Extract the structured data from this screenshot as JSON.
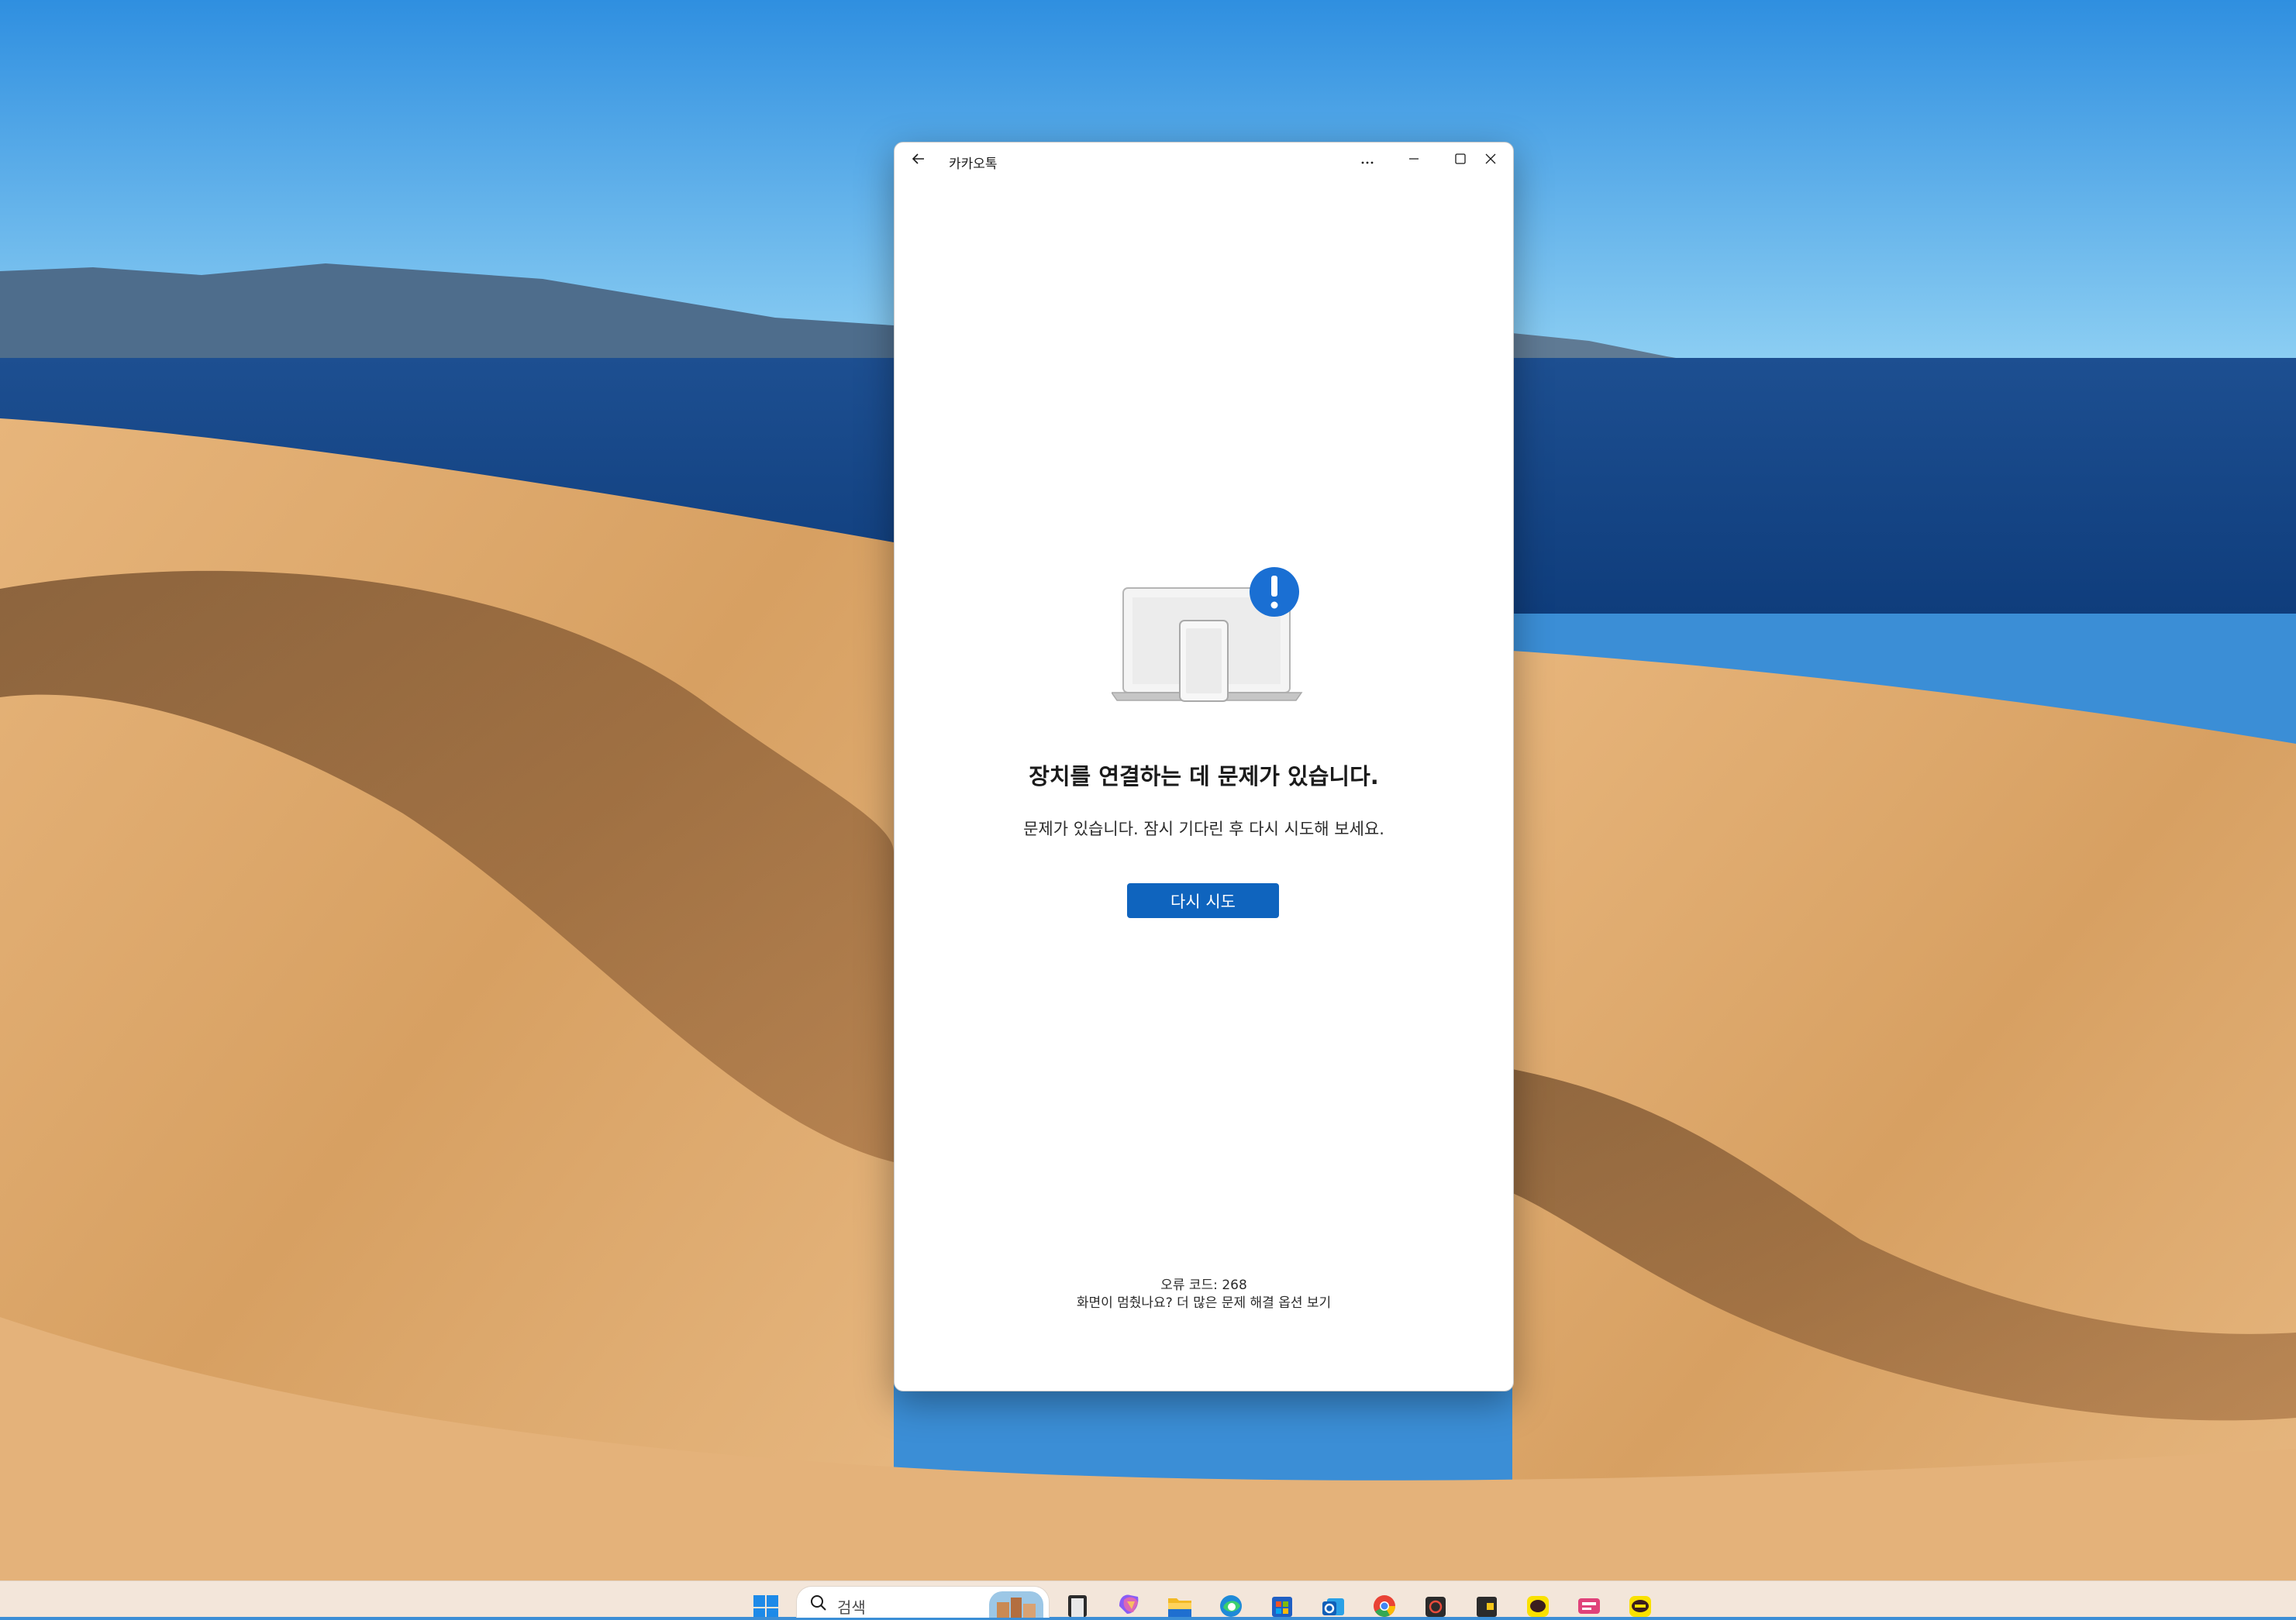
{
  "window": {
    "app_title": "카카오톡",
    "back_icon": "arrow-left-icon",
    "controls": {
      "more_icon": "more-horizontal-icon",
      "minimize_icon": "minimize-icon",
      "maximize_icon": "maximize-icon",
      "close_icon": "close-icon"
    }
  },
  "error": {
    "illustration_icon": "device-connection-error-icon",
    "heading": "장치를 연결하는 데 문제가 있습니다.",
    "message": "문제가 있습니다. 잠시 기다린 후 다시 시도해 보세요.",
    "retry_label": "다시 시도",
    "error_code": "오류 코드: 268",
    "help_link": "화면이 멈췄나요? 더 많은 문제 해결 옵션 보기"
  },
  "taskbar": {
    "search_placeholder": "검색",
    "icons": [
      "windows-start-icon",
      "search-icon",
      "task-view-icon",
      "copilot-icon",
      "file-explorer-icon",
      "edge-icon",
      "microsoft-store-icon",
      "outlook-icon",
      "chrome-icon",
      "app-icon",
      "sticky-app-icon",
      "kakaotalk-icon",
      "chat-app-icon",
      "kakaotalk-talk-icon"
    ]
  },
  "colors": {
    "accent": "#0f64be",
    "alert_badge": "#1a6fd3",
    "taskbar": "#f3e6da"
  }
}
